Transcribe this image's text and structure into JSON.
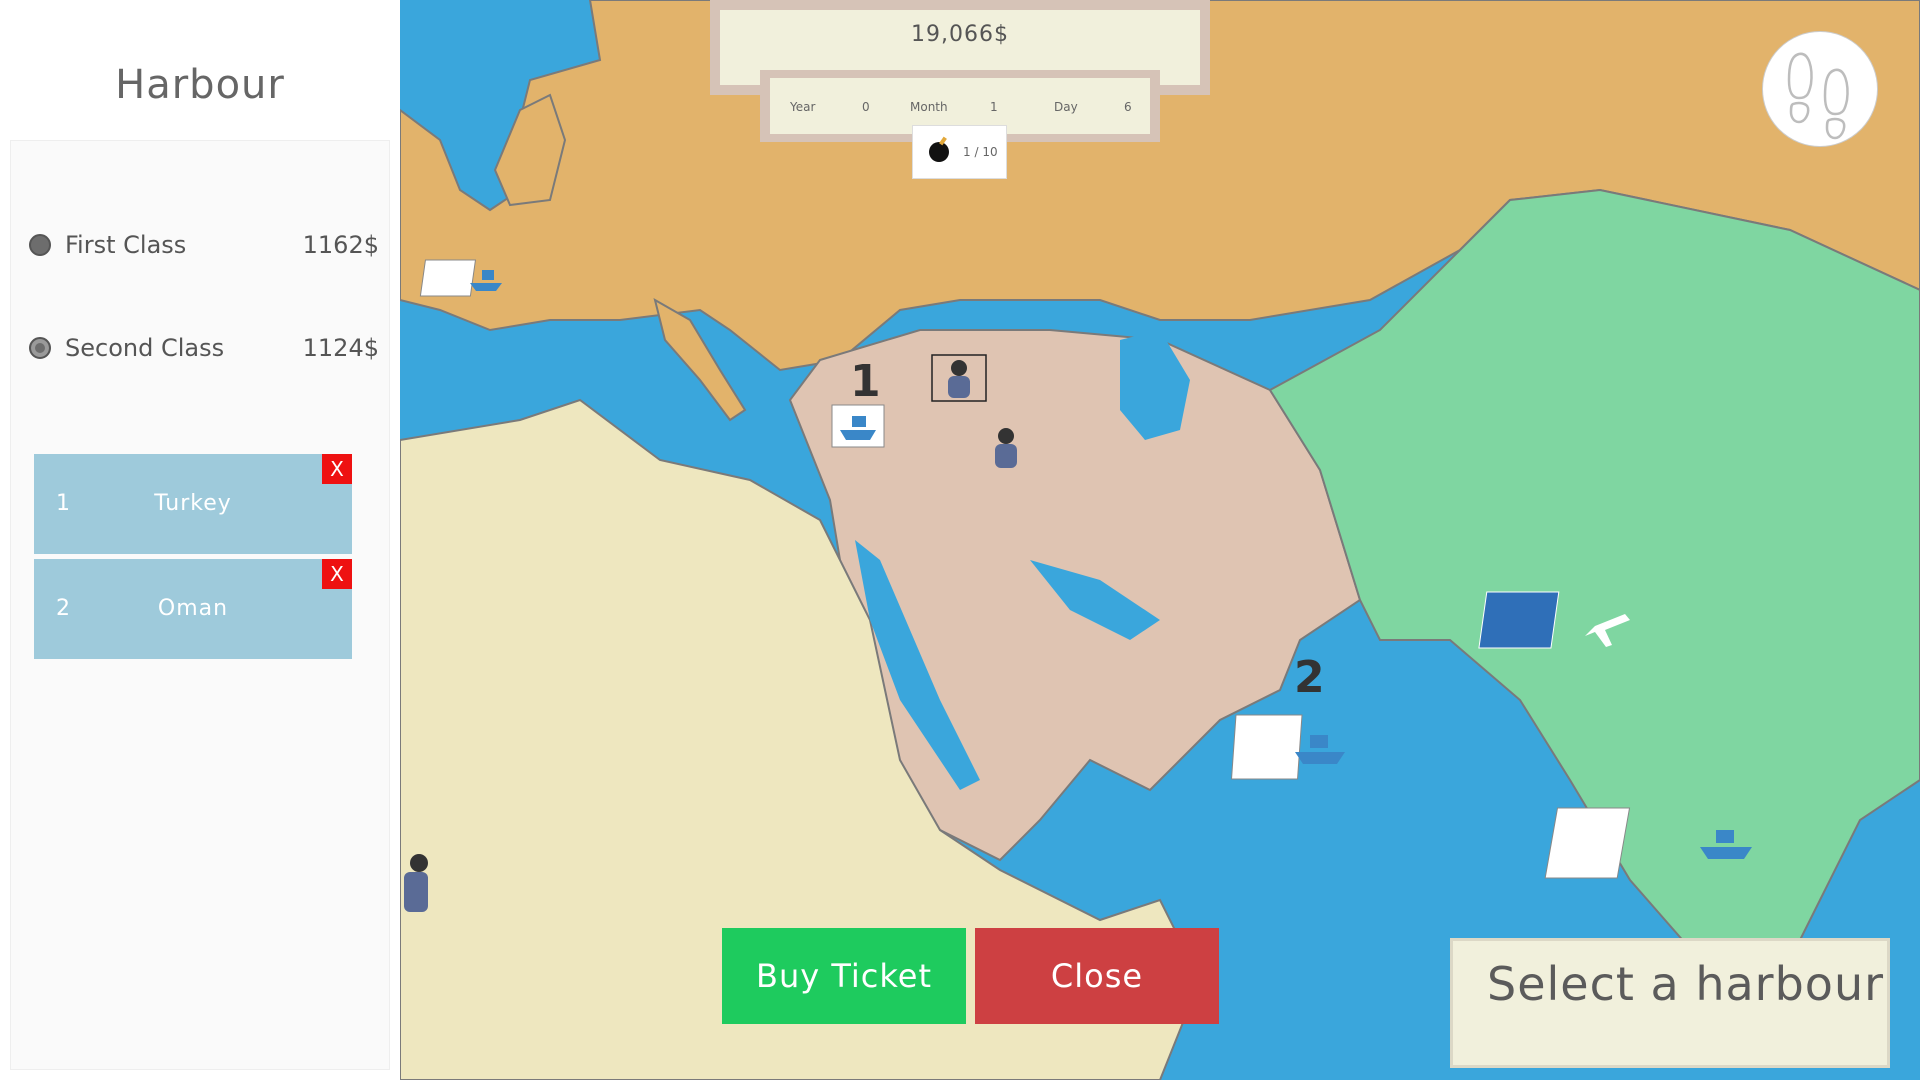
{
  "sidebar": {
    "title": "Harbour",
    "classes": [
      {
        "name": "First Class",
        "price": "1162$"
      },
      {
        "name": "Second Class",
        "price": "1124$"
      }
    ],
    "destinations": [
      {
        "number": "1",
        "name": "Turkey",
        "remove_label": "X"
      },
      {
        "number": "2",
        "name": "Oman",
        "remove_label": "X"
      }
    ]
  },
  "hud": {
    "money": "19,066$",
    "date": {
      "year_label": "Year",
      "year": "0",
      "month_label": "Month",
      "month": "1",
      "day_label": "Day",
      "day": "6"
    },
    "bombs": {
      "count": "1",
      "max": "/ 10"
    }
  },
  "actions": {
    "buy_label": "Buy Ticket",
    "close_label": "Close"
  },
  "prompt": "Select a harbour",
  "map": {
    "markers": {
      "route_1": "1",
      "route_2": "2"
    },
    "colors": {
      "sea": "#3aa6dc",
      "europe": "#e2b36b",
      "africa": "#eee7bf",
      "middle_east": "#dfc4b2",
      "asia": "#7fd6a1"
    }
  }
}
